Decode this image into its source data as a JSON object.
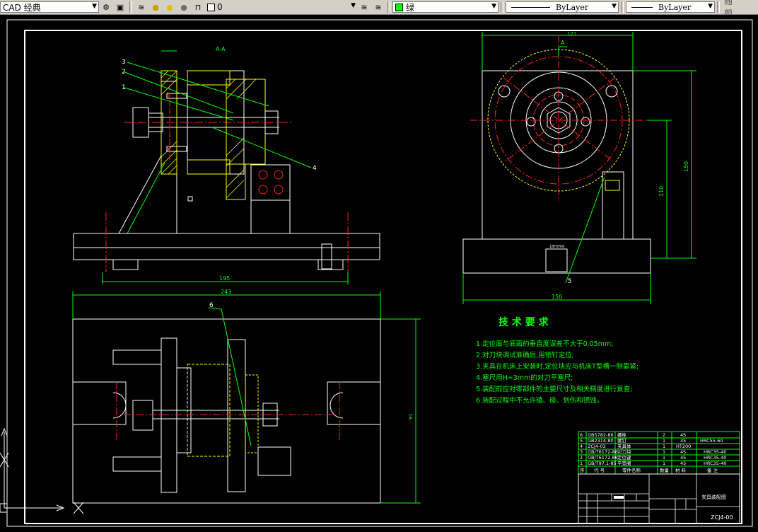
{
  "toolbar": {
    "workspace": "CAD 经典",
    "layer_value": "0",
    "color_value": "绿",
    "linetype_value": "ByLayer",
    "lineweight_value": "ByLayer",
    "plotstyle_value": "随颜"
  },
  "drawing": {
    "section_label": "A-A",
    "callouts": [
      "3",
      "2",
      "1",
      "4",
      "5",
      "6"
    ],
    "view_arrow": "A",
    "dims": {
      "front_bottom": "195",
      "top_overall": "243",
      "side_top": "121",
      "side_height1": "150",
      "side_height2": "110",
      "side_bottom": "150",
      "plan_height": "91",
      "small_slot": "18H7/h6"
    },
    "tech_title": "技 术 要 求",
    "tech_lines": [
      "1.定位面与底面的垂直度误差不大于0.05mm;",
      "2.对刀块调试准确后,用销钉定位;",
      "3.夹具在机床上安装时,定位块应与机床T型槽一侧靠紧;",
      "4.塞尺用H=3mm的对刀平塞尺;",
      "5.装配前应对零部件的主要尺寸及相关精度进行复查;",
      "6.装配过程中不允许磕、碰、划伤和锈蚀。"
    ],
    "bom_rows": [
      [
        "6",
        "GB5782-86",
        "螺栓",
        "2",
        "45",
        "HRC55-60"
      ],
      [
        "5",
        "GB2314-80",
        "螺钉",
        "1",
        "35",
        ""
      ],
      [
        "4",
        "ZCJ4-03",
        "夹具体",
        "1",
        "HT200",
        ""
      ],
      [
        "3",
        "GB/T6172-86",
        "对刀块",
        "1",
        "45",
        "HRC35-40"
      ],
      [
        "2",
        "GB/T6172-86",
        "定位键",
        "1",
        "45",
        "HRC35-40"
      ],
      [
        "1",
        "GB/T97.1-85",
        "平垫圈",
        "1",
        "45",
        "HRC35-40"
      ]
    ],
    "bom_header": [
      "序",
      "代 号",
      "零件名称",
      "数量",
      "材 料",
      "备 注"
    ],
    "title_block_name": "夹具装配图",
    "title_block_code": "ZCJ4-00"
  },
  "colors": {
    "background": "#000000",
    "frame": "#ffffff",
    "dim": "#00ff00",
    "center": "#ff2020",
    "hidden": "#ffff00",
    "cyan": "#00c0ff",
    "hatch": "#ffff00"
  }
}
